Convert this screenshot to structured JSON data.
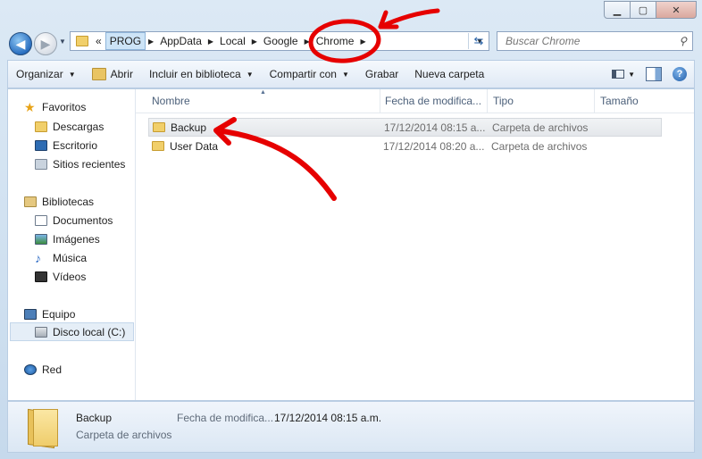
{
  "window": {
    "caption_buttons": [
      "minimize",
      "maximize",
      "close"
    ]
  },
  "address": {
    "overflow": "«",
    "crumbs": [
      "PROG",
      "AppData",
      "Local",
      "Google",
      "Chrome"
    ]
  },
  "search": {
    "placeholder": "Buscar Chrome"
  },
  "toolbar": {
    "organize": "Organizar",
    "open": "Abrir",
    "include": "Incluir en biblioteca",
    "share": "Compartir con",
    "burn": "Grabar",
    "new_folder": "Nueva carpeta",
    "help": "?"
  },
  "nav": {
    "favorites": "Favoritos",
    "downloads": "Descargas",
    "desktop": "Escritorio",
    "recent": "Sitios recientes",
    "libraries": "Bibliotecas",
    "documents": "Documentos",
    "images": "Imágenes",
    "music": "Música",
    "videos": "Vídeos",
    "computer": "Equipo",
    "local_disk": "Disco local (C:)",
    "network": "Red"
  },
  "columns": {
    "name": "Nombre",
    "modified": "Fecha de modifica...",
    "type": "Tipo",
    "size": "Tamaño"
  },
  "files": [
    {
      "name": "Backup",
      "modified": "17/12/2014 08:15 a...",
      "type": "Carpeta de archivos",
      "selected": true
    },
    {
      "name": "User Data",
      "modified": "17/12/2014 08:20 a...",
      "type": "Carpeta de archivos",
      "selected": false
    }
  ],
  "details": {
    "name": "Backup",
    "type": "Carpeta de archivos",
    "date_label": "Fecha de modifica...",
    "date_value": "17/12/2014 08:15 a.m."
  },
  "colors": {
    "annotation": "#e60000",
    "accent": "#2a6fc0"
  }
}
